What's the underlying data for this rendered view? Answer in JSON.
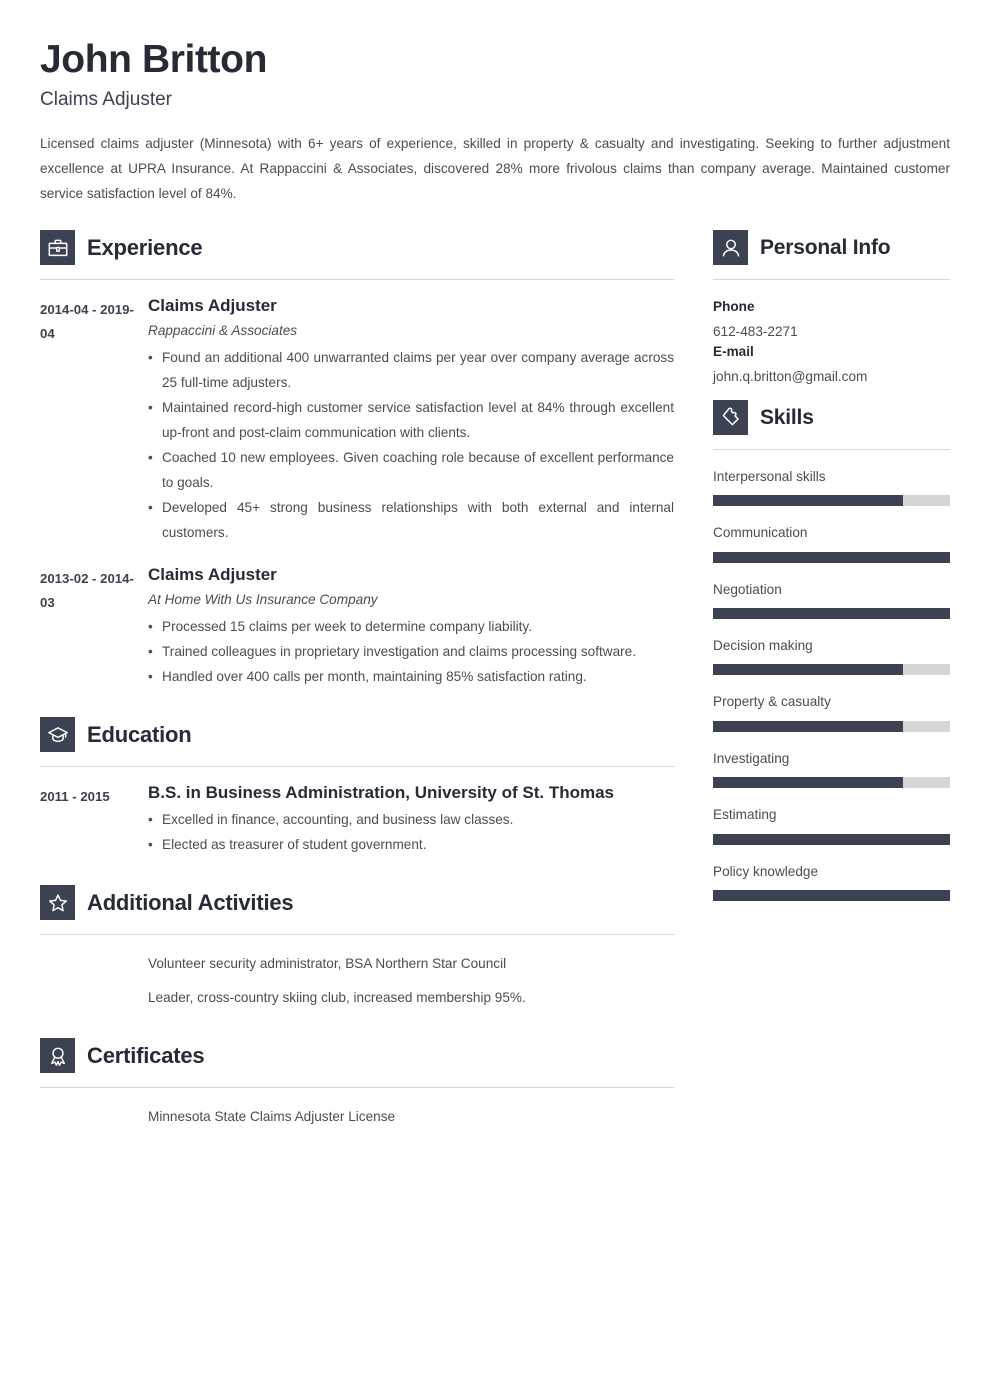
{
  "header": {
    "full_name": "John Britton",
    "job_title": "Claims Adjuster",
    "summary": "Licensed claims adjuster (Minnesota) with 6+ years of experience, skilled in property & casualty and investigating. Seeking to further adjustment excellence at UPRA Insurance. At Rappaccini & Associates, discovered 28% more frivolous claims than company average. Maintained customer service satisfaction level of 84%."
  },
  "theme": {
    "accent_dark": "#3c4252",
    "heading_color": "#262b36",
    "body_color": "#4d4d4d",
    "rule_color": "#d7d7d7",
    "track_color": "#d5d6d8"
  },
  "sections": {
    "experience": {
      "title": "Experience",
      "icon": "briefcase-icon",
      "entries": [
        {
          "date": "2014-04 - 2019-04",
          "role": "Claims Adjuster",
          "org": "Rappaccini & Associates",
          "bullets": [
            "Found an additional 400 unwarranted claims per year over company average across 25 full-time adjusters.",
            "Maintained record-high customer service satisfaction level at 84% through excellent up-front and post-claim communication with clients.",
            "Coached 10 new employees. Given coaching role because of excellent performance to goals.",
            "Developed 45+ strong business relationships with both external and internal customers."
          ]
        },
        {
          "date": "2013-02 - 2014-03",
          "role": "Claims Adjuster",
          "org": "At Home With Us Insurance Company",
          "bullets": [
            "Processed 15 claims per week to determine company liability.",
            "Trained colleagues in proprietary investigation and claims processing software.",
            "Handled over 400 calls per month, maintaining 85% satisfaction rating."
          ]
        }
      ]
    },
    "education": {
      "title": "Education",
      "icon": "graduation-cap-icon",
      "entries": [
        {
          "date": "2011 - 2015",
          "degree": "B.S. in Business Administration, University of St. Thomas",
          "bullets": [
            "Excelled in finance, accounting, and business law classes.",
            "Elected as treasurer of student government."
          ]
        }
      ]
    },
    "additional_activities": {
      "title": "Additional Activities",
      "icon": "star-icon",
      "lines": [
        "Volunteer security administrator, BSA Northern Star Council",
        "Leader, cross-country skiing club, increased membership 95%."
      ]
    },
    "certificates": {
      "title": "Certificates",
      "icon": "award-ribbon-icon",
      "lines": [
        "Minnesota State Claims Adjuster License"
      ]
    },
    "personal_info": {
      "title": "Personal Info",
      "icon": "person-icon",
      "fields": [
        {
          "label": "Phone",
          "value": "612-483-2271"
        },
        {
          "label": "E-mail",
          "value": "john.q.britton@gmail.com"
        }
      ]
    },
    "skills": {
      "title": "Skills",
      "icon": "puzzle-piece-icon",
      "items": [
        {
          "name": "Interpersonal skills",
          "level": 80
        },
        {
          "name": "Communication",
          "level": 100
        },
        {
          "name": "Negotiation",
          "level": 100
        },
        {
          "name": "Decision making",
          "level": 80
        },
        {
          "name": "Property & casualty",
          "level": 80
        },
        {
          "name": "Investigating",
          "level": 80
        },
        {
          "name": "Estimating",
          "level": 100
        },
        {
          "name": "Policy knowledge",
          "level": 100
        }
      ]
    }
  }
}
